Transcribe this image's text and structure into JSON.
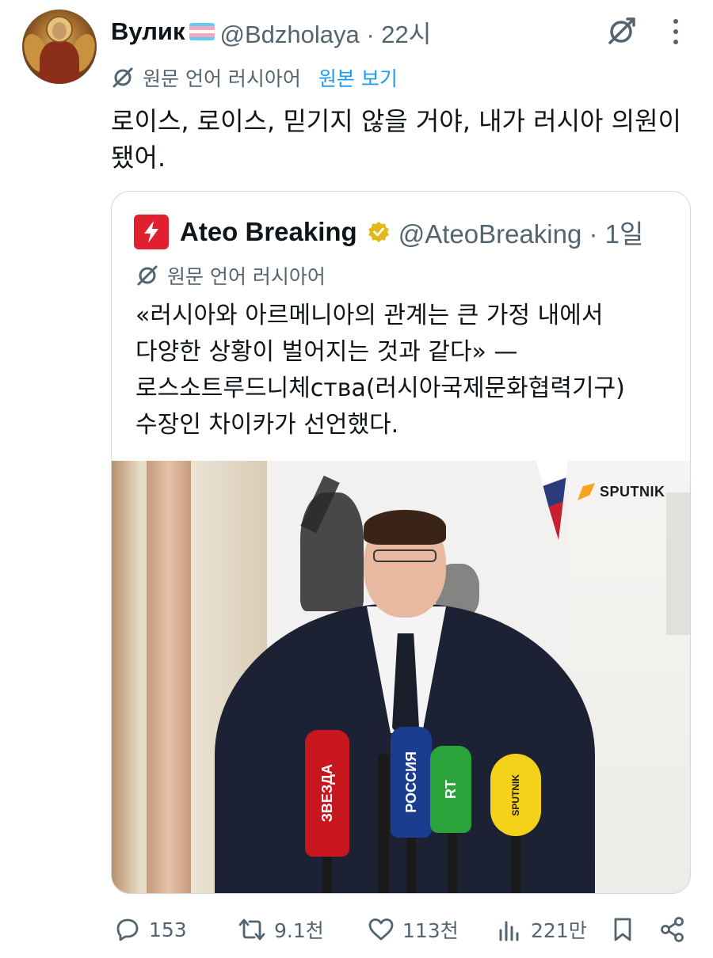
{
  "author": {
    "display_name": "Вулик",
    "handle_time": "@Bdzholaya · 22시"
  },
  "translation": {
    "label": "원문 언어 러시아어",
    "show_original": "원본 보기"
  },
  "tweet": {
    "text_line1": "로이스, 로이스, 믿기지 않을 거야, 내가 러시아 의원이",
    "text_line2": "됐어."
  },
  "quote": {
    "name": "Ateo Breaking",
    "handle_time": "@AteoBreaking · 1일",
    "translation_label": "원문 언어 러시아어",
    "text_line1": "«러시아와 아르메니아의 관계는 큰 가정 내에서",
    "text_line2": "다양한 상황이 벌어지는 것과 같다» —",
    "text_line3": "로스소트루드니체ства(러시아국제문화협력기구)",
    "text_line4": "수장인 차이카가 선언했다.",
    "image": {
      "logo_text": "SPUTNIK",
      "mic_labels": [
        "ЗВЕЗДА",
        "РОССИЯ",
        "RT",
        "SPUTNIK"
      ]
    }
  },
  "actions": {
    "replies": "153",
    "reposts": "9.1천",
    "likes": "113천",
    "views": "221만"
  },
  "icons": [
    "mute-icon",
    "more-icon",
    "translate-icon",
    "verified-icon",
    "reply-icon",
    "repost-icon",
    "like-icon",
    "views-icon",
    "bookmark-icon",
    "share-icon"
  ],
  "colors": {
    "link": "#1d9bf0",
    "secondary_text": "#536471",
    "verified_gold": "#e2b719",
    "ateo_red": "#e0202e"
  }
}
